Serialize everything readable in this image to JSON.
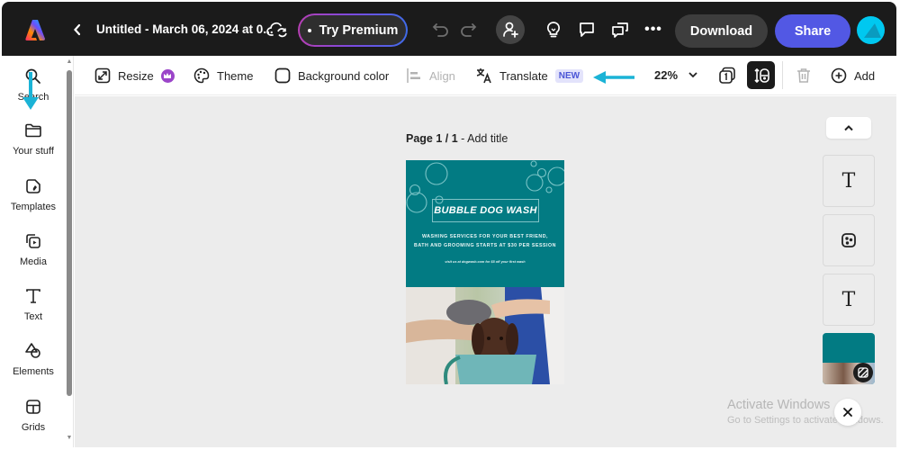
{
  "header": {
    "logo": "adobe-express-logo",
    "back_icon": "chevron-left-icon",
    "document_title": "Untitled - March 06, 2024 at 0...",
    "cloud_status_icon": "cloud-sync-icon",
    "try_premium_label": "Try Premium",
    "undo_icon": "undo-icon",
    "redo_icon": "redo-icon",
    "invite_icon": "add-user-icon",
    "ideas_icon": "lightbulb-icon",
    "comment_icon": "comment-icon",
    "comments_panel_icon": "comments-icon",
    "more_label": "•••",
    "download_label": "Download",
    "share_label": "Share",
    "avatar_color": "#00c8f0"
  },
  "sidebar": {
    "items": [
      {
        "id": "search",
        "label": "Search",
        "icon": "search-icon"
      },
      {
        "id": "your-stuff",
        "label": "Your stuff",
        "icon": "folder-icon"
      },
      {
        "id": "templates",
        "label": "Templates",
        "icon": "templates-icon"
      },
      {
        "id": "media",
        "label": "Media",
        "icon": "media-icon"
      },
      {
        "id": "text",
        "label": "Text",
        "icon": "text-icon"
      },
      {
        "id": "elements",
        "label": "Elements",
        "icon": "shapes-icon"
      },
      {
        "id": "grids",
        "label": "Grids",
        "icon": "grid-icon"
      }
    ],
    "scroll_up": "▲",
    "scroll_down": "▼"
  },
  "toolbar": {
    "resize_label": "Resize",
    "theme_label": "Theme",
    "background_color_label": "Background color",
    "align_label": "Align",
    "translate_label": "Translate",
    "translate_badge": "NEW",
    "zoom_value": "22%",
    "add_label": "Add"
  },
  "canvas": {
    "page_label_prefix": "Page 1 / 1",
    "page_label_suffix": " - Add title",
    "design": {
      "background_color": "#027b83",
      "title": "BUBBLE DOG WASH",
      "subtitle_line1": "WASHING SERVICES FOR YOUR BEST FRIEND,",
      "subtitle_line2": "BATH AND GROOMING STARTS AT $30 PER SESSION",
      "promo": "visit us at dogwash.com for $5 off your first wash",
      "photo_description": "Brown labrador being washed in a blue tub"
    }
  },
  "right_rail": {
    "collapse_icon": "chevron-up-icon",
    "layers": [
      {
        "type": "text",
        "glyph": "T"
      },
      {
        "type": "image",
        "glyph": "image-icon"
      },
      {
        "type": "text",
        "glyph": "T"
      },
      {
        "type": "thumbnail",
        "glyph": "page-thumbnail"
      }
    ]
  },
  "overlay": {
    "watermark_title": "Activate Windows",
    "watermark_subtitle": "Go to Settings to activate Windows.",
    "annotation_color": "#1bb3d6"
  }
}
